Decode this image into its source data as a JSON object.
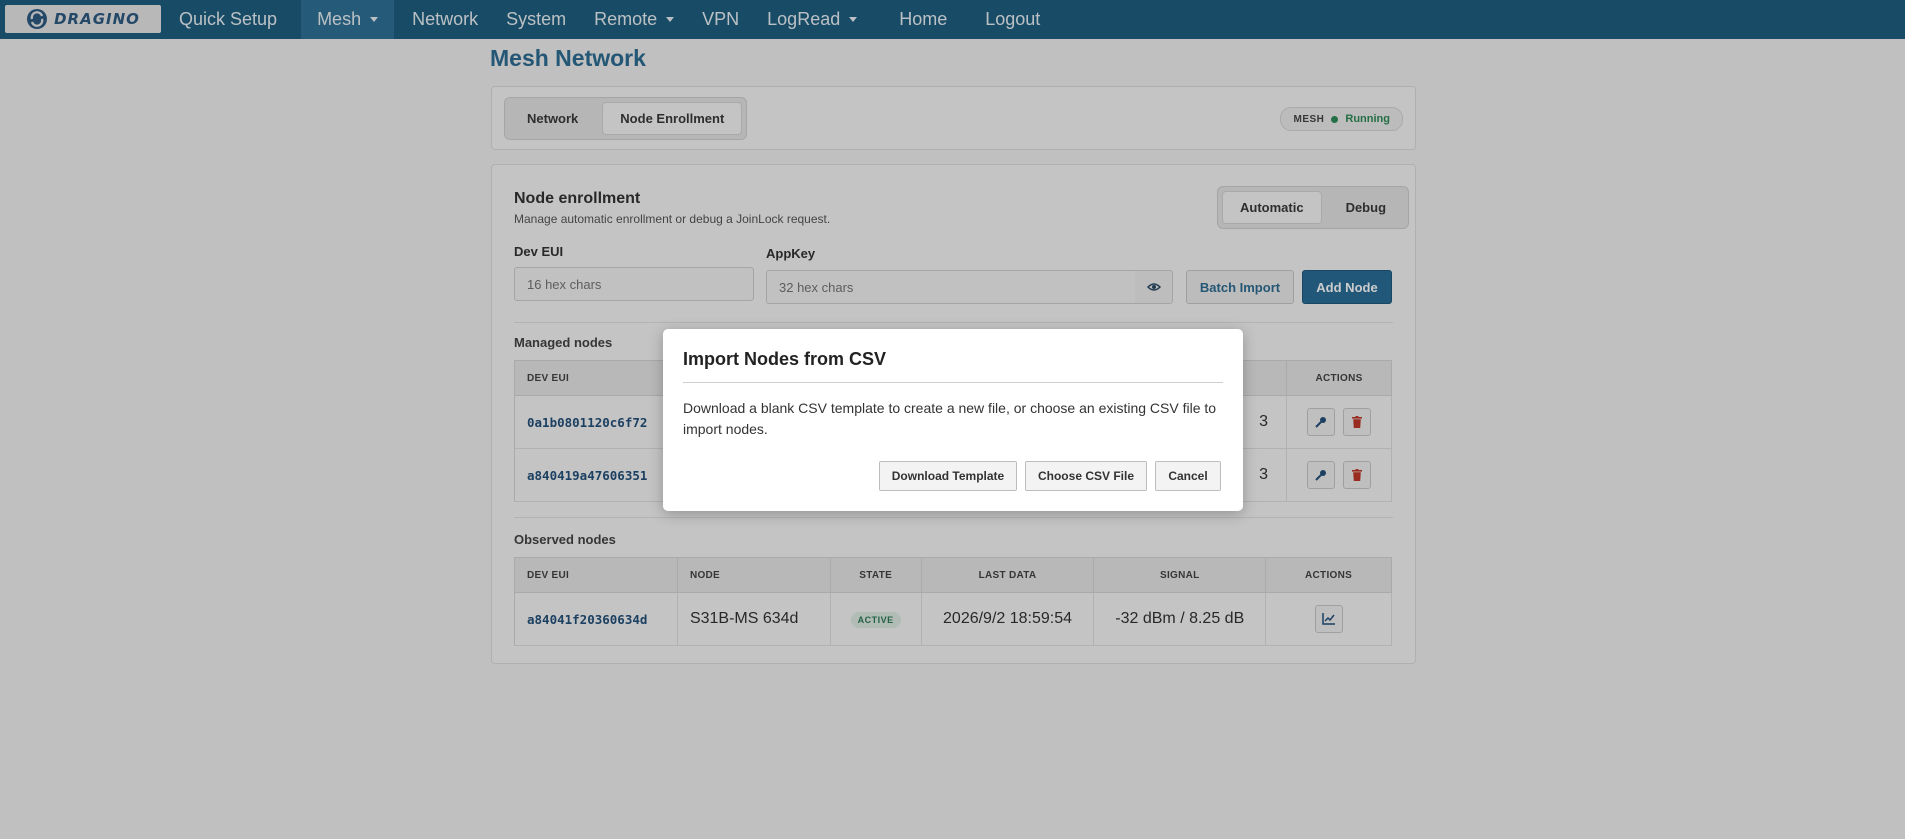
{
  "brand": {
    "logo_text": "DRAGINO"
  },
  "nav": {
    "quick_setup": "Quick Setup",
    "mesh": "Mesh",
    "network": "Network",
    "system": "System",
    "remote": "Remote",
    "vpn": "VPN",
    "logread": "LogRead",
    "home": "Home",
    "logout": "Logout"
  },
  "page": {
    "title": "Mesh Network"
  },
  "tabs": {
    "network": "Network",
    "node_enrollment": "Node Enrollment",
    "active": "node_enrollment"
  },
  "status": {
    "label": "MESH",
    "value": "Running",
    "color": "#2e8b57"
  },
  "enrollment": {
    "title": "Node enrollment",
    "subtitle": "Manage automatic enrollment or debug a JoinLock request.",
    "mode_automatic": "Automatic",
    "mode_debug": "Debug",
    "dev_eui_label": "Dev EUI",
    "dev_eui_placeholder": "16 hex chars",
    "appkey_label": "AppKey",
    "appkey_placeholder": "32 hex chars",
    "batch_import": "Batch Import",
    "add_node": "Add Node"
  },
  "managed": {
    "title": "Managed nodes",
    "col_dev_eui": "DEV EUI",
    "col_actions": "ACTIONS",
    "rows": [
      {
        "dev_eui": "0a1b0801120c6f72",
        "partial": "3"
      },
      {
        "dev_eui": "a840419a47606351",
        "partial": "3"
      }
    ]
  },
  "observed": {
    "title": "Observed nodes",
    "columns": [
      "DEV EUI",
      "NODE",
      "STATE",
      "LAST DATA",
      "SIGNAL",
      "ACTIONS"
    ],
    "rows": [
      {
        "dev_eui": "a84041f20360634d",
        "node": "S31B-MS 634d",
        "state": "ACTIVE",
        "last_data": "2026/9/2 18:59:54",
        "signal": "-32 dBm / 8.25 dB"
      }
    ]
  },
  "modal": {
    "title": "Import Nodes from CSV",
    "body": "Download a blank CSV template to create a new file, or choose an existing CSV file to import nodes.",
    "download_template": "Download Template",
    "choose_csv": "Choose CSV File",
    "cancel": "Cancel"
  },
  "colors": {
    "nav_bg": "#1e5f80",
    "accent": "#2a6f99",
    "danger": "#c0392b"
  },
  "icons": {
    "view": "eye-icon",
    "edit": "key-icon",
    "delete": "trash-icon",
    "chart": "chart-icon"
  }
}
